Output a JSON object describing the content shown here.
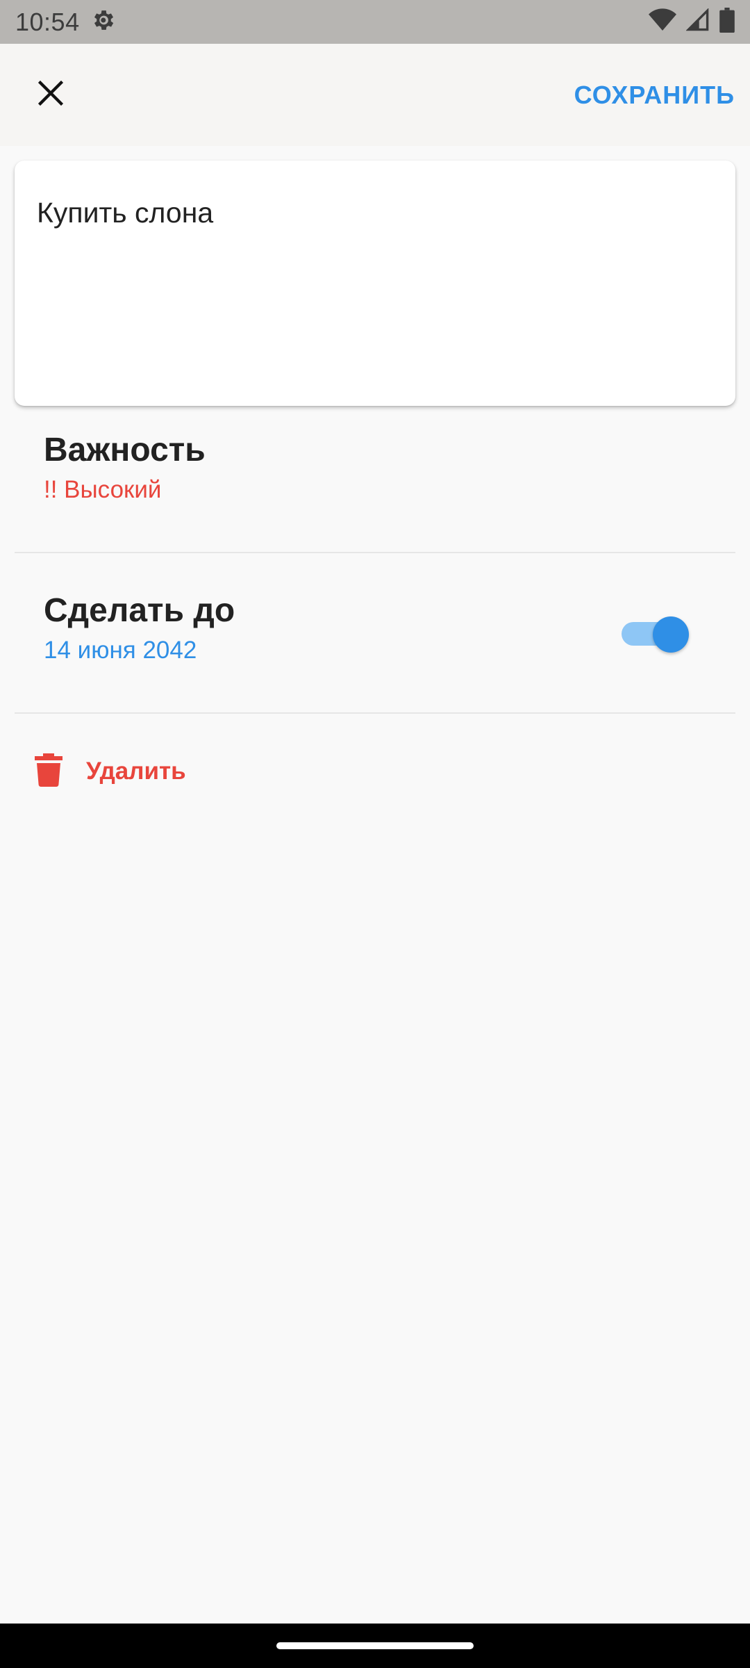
{
  "status_bar": {
    "time": "10:54",
    "icons": [
      "settings-icon",
      "wifi-icon",
      "signal-icon",
      "battery-icon"
    ]
  },
  "app_bar": {
    "close_icon": "close-icon",
    "save_label": "СОХРАНИТЬ"
  },
  "note": {
    "text": "Купить слона"
  },
  "importance": {
    "title": "Важность",
    "value": "!! Высокий"
  },
  "deadline": {
    "title": "Сделать до",
    "date": "14 июня 2042",
    "enabled": true
  },
  "delete": {
    "label": "Удалить",
    "icon": "trash-icon"
  },
  "colors": {
    "accent_blue": "#2f8fe6",
    "danger_red": "#e8453c",
    "background": "#f9f9f9"
  }
}
